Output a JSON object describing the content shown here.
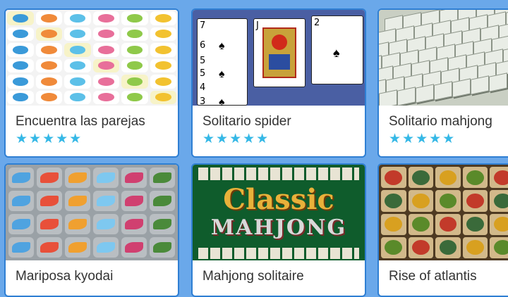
{
  "games": [
    {
      "title": "Encuentra las parejas",
      "stars": "★★★★★"
    },
    {
      "title": "Solitario spider",
      "stars": "★★★★★"
    },
    {
      "title": "Solitario mahjong",
      "stars": "★★★★★"
    },
    {
      "title": "Mariposa kyodai",
      "stars": ""
    },
    {
      "title": "Mahjong solitaire",
      "stars": ""
    },
    {
      "title": "Rise of atlantis",
      "stars": ""
    }
  ],
  "thumbnails": {
    "solitaire_ranks": [
      "7",
      "6",
      "5",
      "5",
      "4",
      "3",
      "J",
      "2"
    ],
    "classic_mahjong": {
      "line1": "Classic",
      "line2": "MAHJONG"
    }
  },
  "colors": {
    "background": "#6aa8ea",
    "card_border": "#2f7fd3",
    "star": "#35b8e6",
    "title_text": "#333333"
  }
}
